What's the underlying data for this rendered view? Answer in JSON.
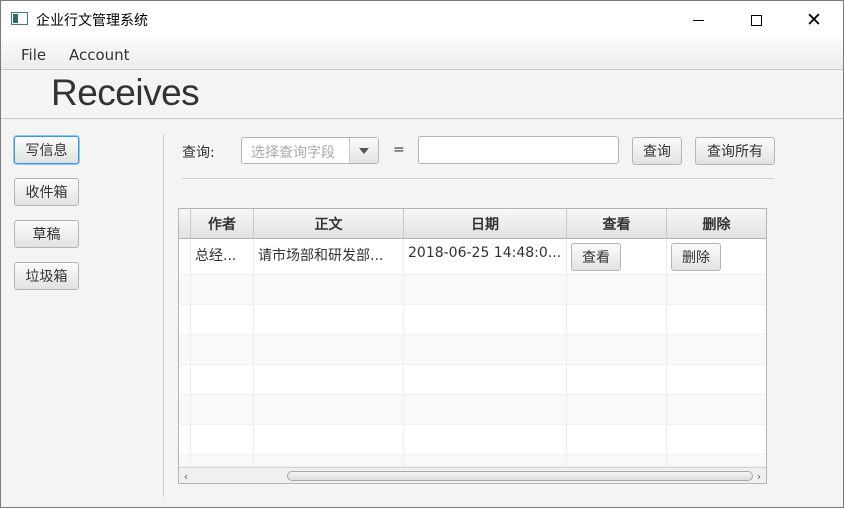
{
  "window": {
    "title": "企业行文管理系统",
    "minimize_glyph": "—",
    "maximize_glyph": "☐",
    "close_glyph": "✕"
  },
  "menu": {
    "items": [
      "File",
      "Account"
    ]
  },
  "page": {
    "title": "Receives"
  },
  "sidebar": {
    "buttons": [
      "写信息",
      "收件箱",
      "草稿",
      "垃圾箱"
    ],
    "focused": "写信息"
  },
  "search": {
    "label": "查询:",
    "field_placeholder": "选择查询字段",
    "equals": "=",
    "value": "",
    "query_button": "查询",
    "query_all_button": "查询所有"
  },
  "table": {
    "columns": [
      "作者",
      "正文",
      "日期",
      "查看",
      "删除"
    ],
    "rows": [
      {
        "first_partial": "",
        "author": "总经...",
        "body": "请市场部和研发部...",
        "date": "2018-06-25 14:48:0...",
        "view_button": "查看",
        "delete_button": "删除"
      }
    ],
    "scroll_left_glyph": "‹",
    "scroll_right_glyph": "›",
    "horizontal_scroll": 1.0
  }
}
